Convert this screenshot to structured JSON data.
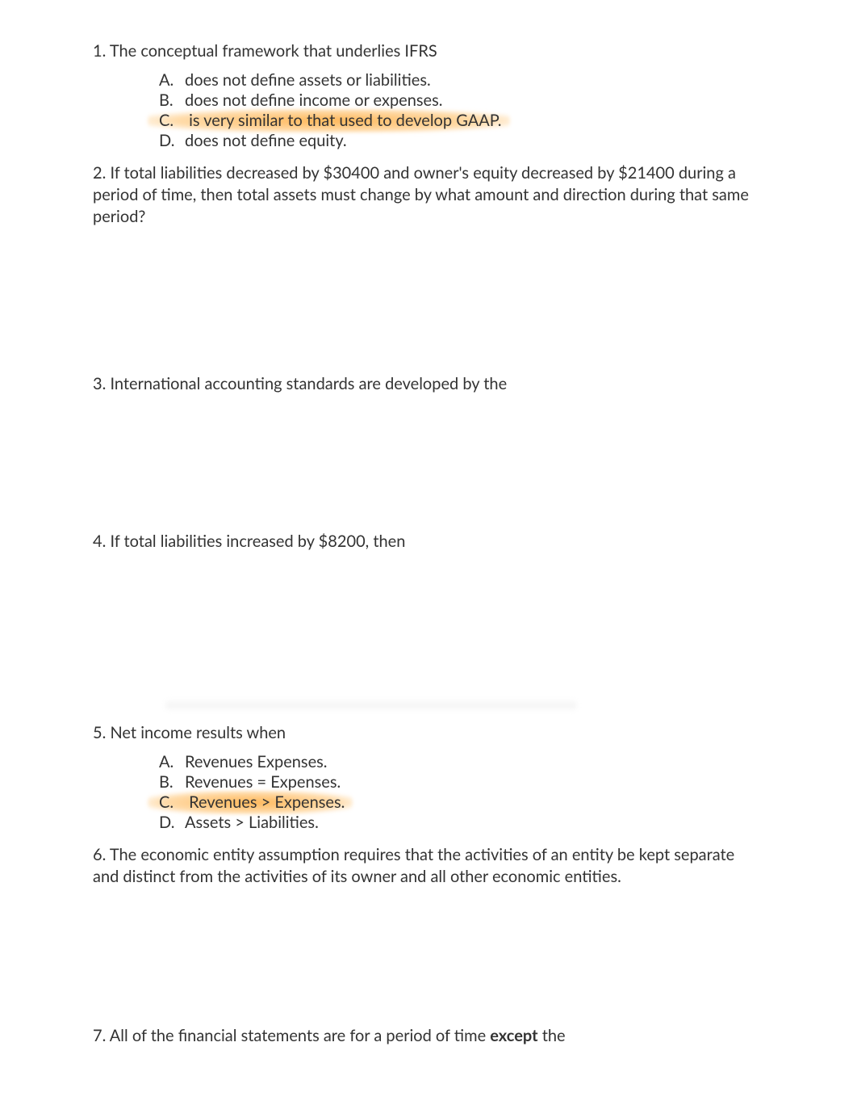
{
  "questions": [
    {
      "number": "1.",
      "text": "The conceptual framework that underlies IFRS",
      "options": [
        {
          "letter": "A.",
          "text": "does not define assets or liabilities.",
          "highlighted": false
        },
        {
          "letter": "B.",
          "text": "does not define income or expenses.",
          "highlighted": false
        },
        {
          "letter": "C.",
          "text": "is very similar to that used to develop GAAP.",
          "highlighted": true
        },
        {
          "letter": "D.",
          "text": "does not define equity.",
          "highlighted": false
        }
      ]
    },
    {
      "number": "2.",
      "text": "If total liabilities decreased by $30400 and owner's equity decreased by $21400 during a period of time, then total assets must change by what amount and direction during that same period?",
      "options": []
    },
    {
      "number": "3.",
      "text": "International accounting standards are developed by the",
      "options": []
    },
    {
      "number": "4.",
      "text": "If total liabilities increased by $8200, then",
      "options": []
    },
    {
      "number": "5.",
      "text": "Net income results when",
      "options": [
        {
          "letter": "A.",
          "text": "Revenues Expenses.",
          "highlighted": false
        },
        {
          "letter": "B.",
          "text": "Revenues = Expenses.",
          "highlighted": false
        },
        {
          "letter": "C.",
          "text": "Revenues > Expenses.",
          "highlighted": true
        },
        {
          "letter": "D.",
          "text": "Assets > Liabilities.",
          "highlighted": false
        }
      ]
    },
    {
      "number": "6.",
      "text": "The economic entity assumption requires that the activities of an entity be kept separate and distinct from the activities of its owner and all other economic entities.",
      "options": []
    },
    {
      "number": "7.",
      "text_pre": "All of the financial statements are for a period of time ",
      "text_bold": "except",
      "text_post": " the",
      "options": []
    }
  ]
}
